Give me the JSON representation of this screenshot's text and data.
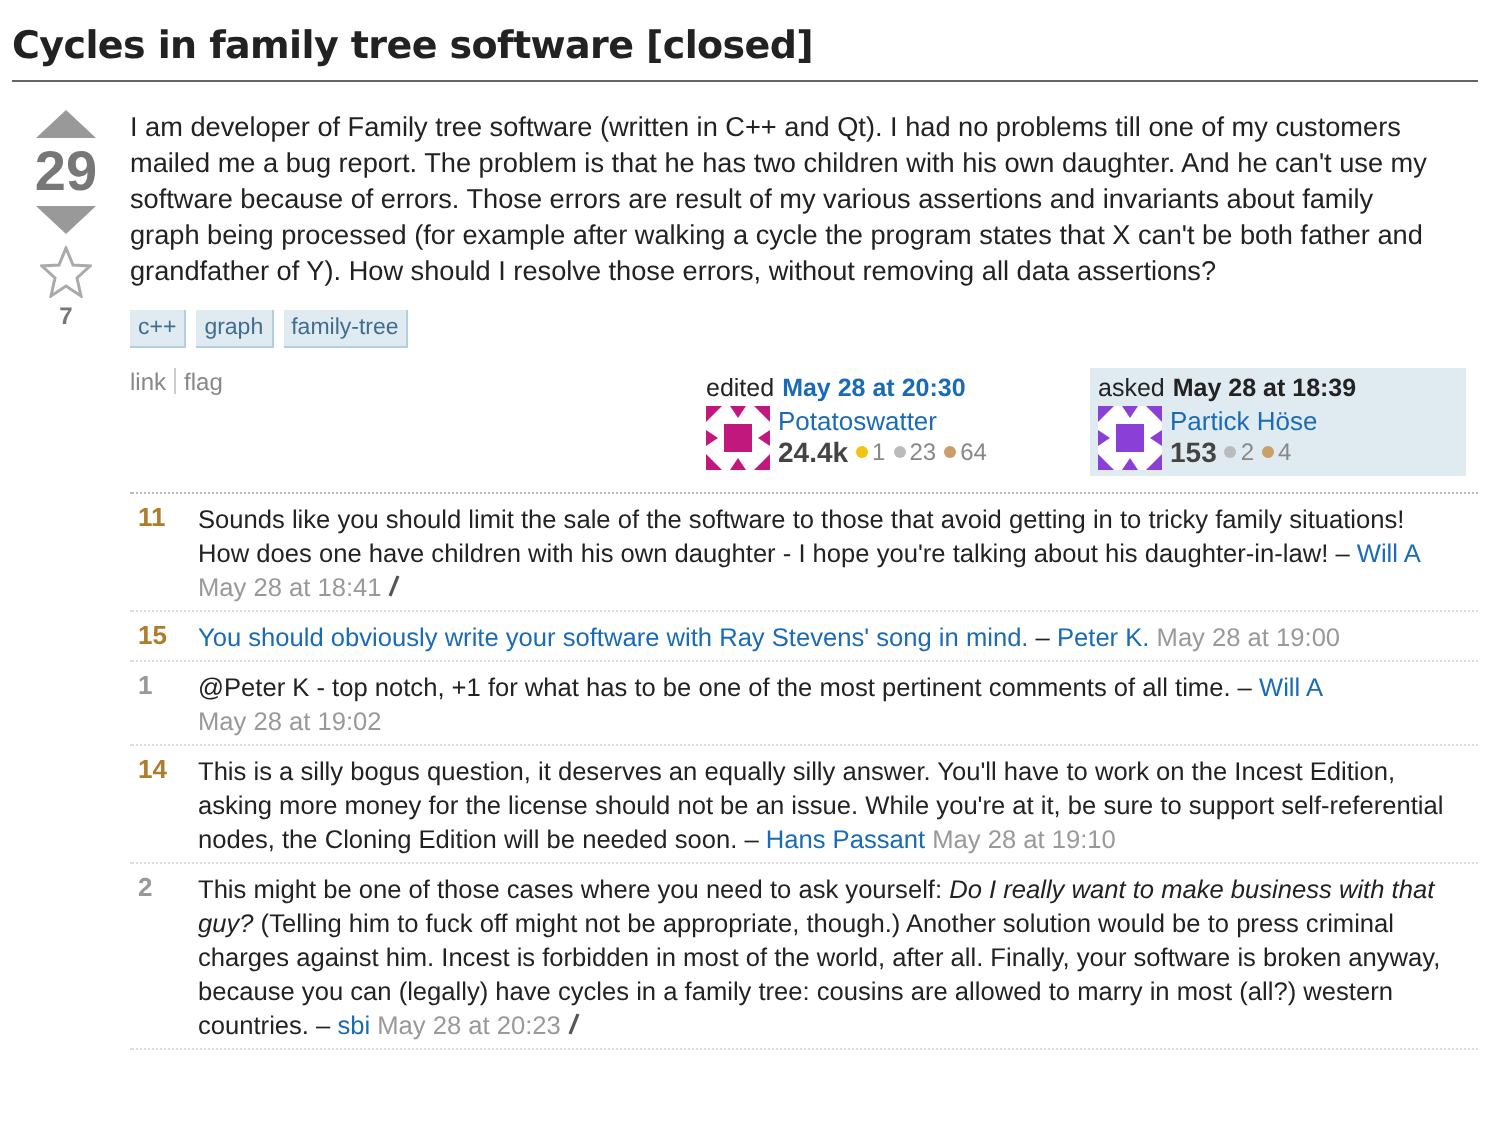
{
  "title": "Cycles in family tree software [closed]",
  "question": {
    "votes": "29",
    "favorites": "7",
    "favorited": false,
    "body": "I am developer of Family tree software (written in C++ and Qt). I had no problems till one of my customers mailed me a bug report. The problem is that he has two children with his own daughter. And he can't use my software because of errors. Those errors are result of my various assertions and invariants about family graph being processed (for example after walking a cycle the program states that X can't be both father and grandfather of Y). How should I resolve those errors, without removing all data assertions?",
    "tags": [
      "c++",
      "graph",
      "family-tree"
    ],
    "actions": [
      "link",
      "flag"
    ],
    "signatures": [
      {
        "kind": "edited",
        "verb": "edited",
        "time": "May 28 at 20:30",
        "user": "Potatoswatter",
        "reputation": "24.4k",
        "color": "#c0187c",
        "badges": [
          {
            "kind": "gold",
            "count": "1"
          },
          {
            "kind": "silver",
            "count": "23"
          },
          {
            "kind": "bronze",
            "count": "64"
          }
        ]
      },
      {
        "kind": "asked",
        "verb": "asked",
        "time": "May 28 at 18:39",
        "user": "Partick Höse",
        "reputation": "153",
        "color": "#8a3fd6",
        "badges": [
          {
            "kind": "silver",
            "count": "2"
          },
          {
            "kind": "bronze",
            "count": "4"
          }
        ]
      }
    ]
  },
  "comments": [
    {
      "score": "11",
      "hot": true,
      "kind": "text",
      "text": "Sounds like you should limit the sale of the software to those that avoid getting in to tricky family situations! How does one have children with his own daughter - I hope you're talking about his daughter-in-law!",
      "separator": "–",
      "author": "Will A",
      "time": "May 28 at 18:41",
      "edited": true
    },
    {
      "score": "15",
      "hot": true,
      "kind": "link",
      "text": "You should obviously write your software with Ray Stevens' song in mind.",
      "separator": "–",
      "author": "Peter K.",
      "time": "May 28 at 19:00",
      "edited": false
    },
    {
      "score": "1",
      "hot": false,
      "kind": "text",
      "text": "@Peter K - top notch, +1 for what has to be one of the most pertinent comments of all time.",
      "separator": "–",
      "author": "Will A",
      "time": "May 28 at 19:02",
      "edited": false
    },
    {
      "score": "14",
      "hot": true,
      "kind": "text",
      "text": "This is a silly bogus question, it deserves an equally silly answer. You'll have to work on the Incest Edition, asking more money for the license should not be an issue. While you're at it, be sure to support self-referential nodes, the Cloning Edition will be needed soon.",
      "separator": "–",
      "author": "Hans Passant",
      "time": "May 28 at 19:10",
      "edited": false
    },
    {
      "score": "2",
      "hot": false,
      "kind": "text",
      "text": "This might be one of those cases where you need to ask yourself: *Do I really want to make business with that guy?* (Telling him to fuck off might not be appropriate, though.) Another solution would be to press criminal charges against him. Incest is forbidden in most of the world, after all. Finally, your software is broken anyway, because you can (legally) have cycles in a family tree: cousins are allowed to marry in most (all?) western countries.",
      "separator": "–",
      "author": "sbi",
      "time": "May 28 at 20:23",
      "edited": true
    }
  ]
}
